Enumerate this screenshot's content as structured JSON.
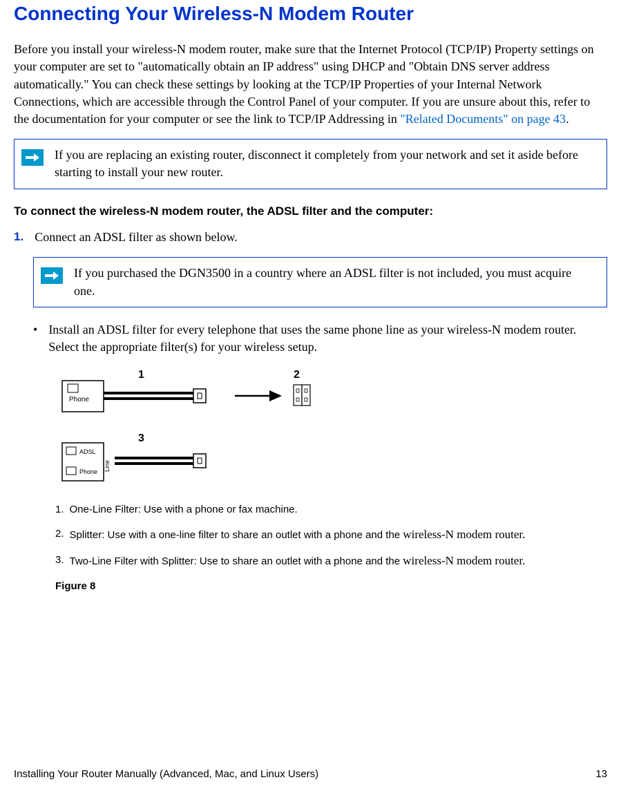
{
  "heading": "Connecting Your Wireless-N Modem Router",
  "intro_part1": "Before you install your wireless-N modem router, make sure that the Internet Protocol (TCP/IP) Property settings on your computer are set to \"automatically obtain an IP address\" using DHCP and \"Obtain DNS server address automatically.\" You can check these settings by looking at the TCP/IP Properties of your Internal Network Connections, which are accessible through the Control Panel of your computer. If you are unsure about this, refer to the documentation for your computer or see the link to TCP/IP Addressing in  ",
  "intro_link": "\"Related Documents\" on page 43",
  "note1": "If you are replacing an existing router, disconnect it completely from your network and set it aside before starting to install your new router.",
  "section_heading": "To connect the wireless-N modem router, the ADSL filter and the computer:",
  "step1_num": "1.",
  "step1_text": "Connect an ADSL filter as shown below.",
  "note2": "If you purchased the DGN3500 in a country where an ADSL filter is not included, you must acquire one.",
  "bullet1": "Install an ADSL filter for every telephone that uses the same phone line as your wireless-N modem router. Select the appropriate filter(s) for your wireless setup.",
  "fig_labels": {
    "l1": "1",
    "l2": "2",
    "l3": "3"
  },
  "svg_text": {
    "phone": "Phone",
    "adsl": "ADSL",
    "phone2": "Phone",
    "line": "Line"
  },
  "subitem1_num": "1.",
  "subitem1_text": "One-Line Filter: Use with a phone or fax machine.",
  "subitem2_num": "2.",
  "subitem2_a": "Splitter: Use with a one-line filter to share an outlet with a phone and the ",
  "subitem2_b": "wireless-N modem router",
  "subitem3_num": "3.",
  "subitem3_a": "Two-Line Filter with Splitter: Use to share an outlet with a phone and the ",
  "subitem3_b": "wireless-N modem router",
  "figure_caption": "Figure 8",
  "footer_left": "Installing Your Router Manually (Advanced, Mac, and Linux Users)",
  "footer_right": "13"
}
